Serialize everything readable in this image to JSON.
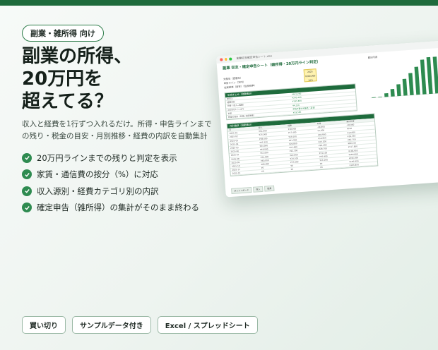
{
  "tag": "副業・雑所得 向け",
  "headline": [
    "副業の所得、",
    "20万円を",
    "超えてる？"
  ],
  "subtext": [
    "収入と経費を1行ずつ入れるだけ。所得・申告ラインまで",
    "の残り・税金の目安・月別推移・経費の内訳を自動集計"
  ],
  "features": [
    "20万円ラインまでの残りと判定を表示",
    "家賃・通信費の按分（%）に対応",
    "収入源別・経費カテゴリ別の内訳",
    "確定申告（雑所得）の集計がそのまま終わる"
  ],
  "pills": [
    "買い切り",
    "サンプルデータ付き",
    "Excel / スプレッドシート"
  ],
  "colors": {
    "accent": "#1e6b3c",
    "check": "#2e8b50",
    "bar": "#2e8b50"
  },
  "sheet": {
    "filename": "副業収支確定申告シート.xlsx",
    "title": "副業 収支・確定申告シート（雑所得・20万円ライン判定）",
    "kv": [
      "対象年（西暦年）",
      "申告ライン（万円）",
      "住民税率（目安）（住民税率）"
    ],
    "yellow": [
      "2025",
      "¥200,000",
      "10%"
    ],
    "summary_header": "年間まとめ（自動集計）",
    "summary_rows": [
      [
        "総収入",
        "¥441,250"
      ],
      [
        "経費合計",
        "¥245,400"
      ],
      [
        "所得（収入−経費）",
        "¥195,850"
      ],
      [
        "20万円ラインまで",
        "¥4,150"
      ],
      [
        "判定",
        "申告不要の可能性（目安）"
      ],
      [
        "税金の目安（所得×住民税率）",
        "¥19,585"
      ]
    ],
    "monthly_header": "月別推移（自動集計）",
    "monthly_cols": [
      "月",
      "収入",
      "経費",
      "所得",
      "累計所得"
    ],
    "monthly_rows": [
      [
        "2025-01",
        "¥12,000",
        "¥18,900",
        "-¥6,900",
        "-¥6,900"
      ],
      [
        "2025-02",
        "¥25,000",
        "¥17,400",
        "¥7,600",
        "¥700"
      ],
      [
        "2025-03",
        "¥38,000",
        "¥19,100",
        "¥18,900",
        "¥19,600"
      ],
      [
        "2025-04",
        "¥41,250",
        "¥21,300",
        "¥19,950",
        "¥39,550"
      ],
      [
        "2025-05",
        "¥44,000",
        "¥20,800",
        "¥23,200",
        "¥62,750"
      ],
      [
        "2025-06",
        "¥48,000",
        "¥21,600",
        "¥26,400",
        "¥89,150"
      ],
      [
        "2025-07",
        "¥51,000",
        "¥22,300",
        "¥28,700",
        "¥117,850"
      ],
      [
        "2025-08",
        "¥54,000",
        "¥22,900",
        "¥31,100",
        "¥148,950"
      ],
      [
        "2025-09",
        "¥60,000",
        "¥24,100",
        "¥35,900",
        "¥184,850"
      ],
      [
        "2025-10",
        "¥68,000",
        "¥57,000",
        "¥11,000",
        "¥195,850"
      ],
      [
        "2025-11",
        "¥0",
        "¥0",
        "¥0",
        "¥195,850"
      ],
      [
        "2025-12",
        "¥0",
        "¥0",
        "¥0",
        "¥195,850"
      ]
    ],
    "tabs": [
      "ダッシュボード",
      "収入",
      "経費"
    ],
    "chart_label": "累計所得",
    "chart_values": [
      -6900,
      700,
      19600,
      39550,
      62750,
      89150,
      117850,
      148950,
      184850,
      195850,
      195850,
      195850
    ]
  }
}
